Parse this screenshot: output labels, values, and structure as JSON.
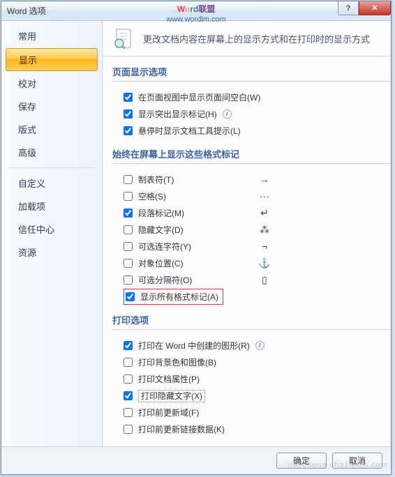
{
  "titlebar": {
    "title": "Word 选项"
  },
  "watermark": {
    "line1_pre": "W",
    "line1_o": "o",
    "line1_r": "r",
    "line1_d": "d",
    "line1_suffix": "联盟",
    "line2": "www.wordlm.com"
  },
  "sidebar": {
    "items": [
      "常用",
      "显示",
      "校对",
      "保存",
      "版式",
      "高级"
    ],
    "items2": [
      "自定义",
      "加载项",
      "信任中心",
      "资源"
    ]
  },
  "main": {
    "header_text": "更改文档内容在屏幕上的显示方式和在打印时的显示方式",
    "section1": {
      "title": "页面显示选项",
      "opts": [
        {
          "label": "在页面视图中显示页面间空白(W)",
          "checked": true
        },
        {
          "label": "显示突出显示标记(H)",
          "checked": true,
          "info": true
        },
        {
          "label": "悬停时显示文档工具提示(L)",
          "checked": true
        }
      ]
    },
    "section2": {
      "title": "始终在屏幕上显示这些格式标记",
      "opts": [
        {
          "label": "制表符(T)",
          "checked": false,
          "sym": "→"
        },
        {
          "label": "空格(S)",
          "checked": false,
          "sym": "···"
        },
        {
          "label": "段落标记(M)",
          "checked": true,
          "sym": "↵"
        },
        {
          "label": "隐藏文字(D)",
          "checked": false,
          "sym": "⁂"
        },
        {
          "label": "可选连字符(Y)",
          "checked": false,
          "sym": "¬"
        },
        {
          "label": "对象位置(C)",
          "checked": false,
          "sym": "⚓"
        },
        {
          "label": "可选分隔符(O)",
          "checked": false,
          "sym": "▯"
        }
      ],
      "showall": {
        "label": "显示所有格式标记(A)",
        "checked": true
      }
    },
    "section3": {
      "title": "打印选项",
      "opts": [
        {
          "label": "打印在 Word 中创建的图形(R)",
          "checked": true,
          "info": true
        },
        {
          "label": "打印背景色和图像(B)",
          "checked": false
        },
        {
          "label": "打印文档属性(P)",
          "checked": false
        },
        {
          "label": "打印隐藏文字(X)",
          "checked": true,
          "hl": true
        },
        {
          "label": "打印前更新域(F)",
          "checked": false
        },
        {
          "label": "打印前更新链接数据(K)",
          "checked": false
        }
      ]
    }
  },
  "footer": {
    "ok": "确定",
    "cancel": "取消"
  },
  "bottom_wm": "jiaocheng.chazidian.com"
}
